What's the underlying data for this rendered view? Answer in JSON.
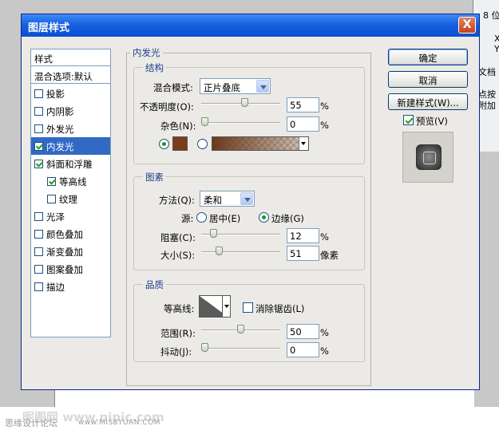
{
  "background": {
    "panel_lines": [
      "8 位",
      "X:",
      "Y:",
      "文档",
      "点按",
      "附加"
    ],
    "watermark_logo": "昵图网 www.nipic.com",
    "watermark_site": "思缘设计论坛",
    "watermark_url": "www.MISSYUAN.COM"
  },
  "dialog": {
    "title": "图层样式",
    "close_label": "X"
  },
  "style_list": {
    "header": "样式",
    "blend_item": "混合选项:默认",
    "items": [
      {
        "label": "投影",
        "checked": false
      },
      {
        "label": "内阴影",
        "checked": false
      },
      {
        "label": "外发光",
        "checked": false
      },
      {
        "label": "内发光",
        "checked": true,
        "selected": true
      },
      {
        "label": "斜面和浮雕",
        "checked": true
      },
      {
        "label": "等高线",
        "checked": true,
        "sub": true
      },
      {
        "label": "纹理",
        "checked": false,
        "sub": true
      },
      {
        "label": "光泽",
        "checked": false
      },
      {
        "label": "颜色叠加",
        "checked": false
      },
      {
        "label": "渐变叠加",
        "checked": false
      },
      {
        "label": "图案叠加",
        "checked": false
      },
      {
        "label": "描边",
        "checked": false
      }
    ]
  },
  "inner_glow": {
    "title": "内发光",
    "structure": {
      "title": "结构",
      "blend_mode_label": "混合模式:",
      "blend_mode_value": "正片叠底",
      "opacity_label": "不透明度(O):",
      "opacity_value": "55",
      "opacity_unit": "%",
      "noise_label": "杂色(N):",
      "noise_value": "0",
      "noise_unit": "%",
      "color_swatch": "#7b3d1b"
    },
    "elements": {
      "title": "图素",
      "method_label": "方法(Q):",
      "method_value": "柔和",
      "source_label": "源:",
      "center_label": "居中(E)",
      "edge_label": "边缘(G)",
      "choke_label": "阻塞(C):",
      "choke_value": "12",
      "choke_unit": "%",
      "size_label": "大小(S):",
      "size_value": "51",
      "size_unit": "像素"
    },
    "quality": {
      "title": "品质",
      "contour_label": "等高线:",
      "antialias_label": "消除锯齿(L)",
      "range_label": "范围(R):",
      "range_value": "50",
      "range_unit": "%",
      "jitter_label": "抖动(J):",
      "jitter_value": "0",
      "jitter_unit": "%"
    }
  },
  "buttons": {
    "ok": "确定",
    "cancel": "取消",
    "new_style": "新建样式(W)...",
    "preview_label": "预览(V)"
  },
  "slider_levels": {
    "opacity": 0.55,
    "noise": 0,
    "choke": 0.12,
    "size": 0.2,
    "range": 0.5,
    "jitter": 0
  },
  "colors": {
    "accent": "#316ac5",
    "titlebar": "#0a4fd0"
  }
}
